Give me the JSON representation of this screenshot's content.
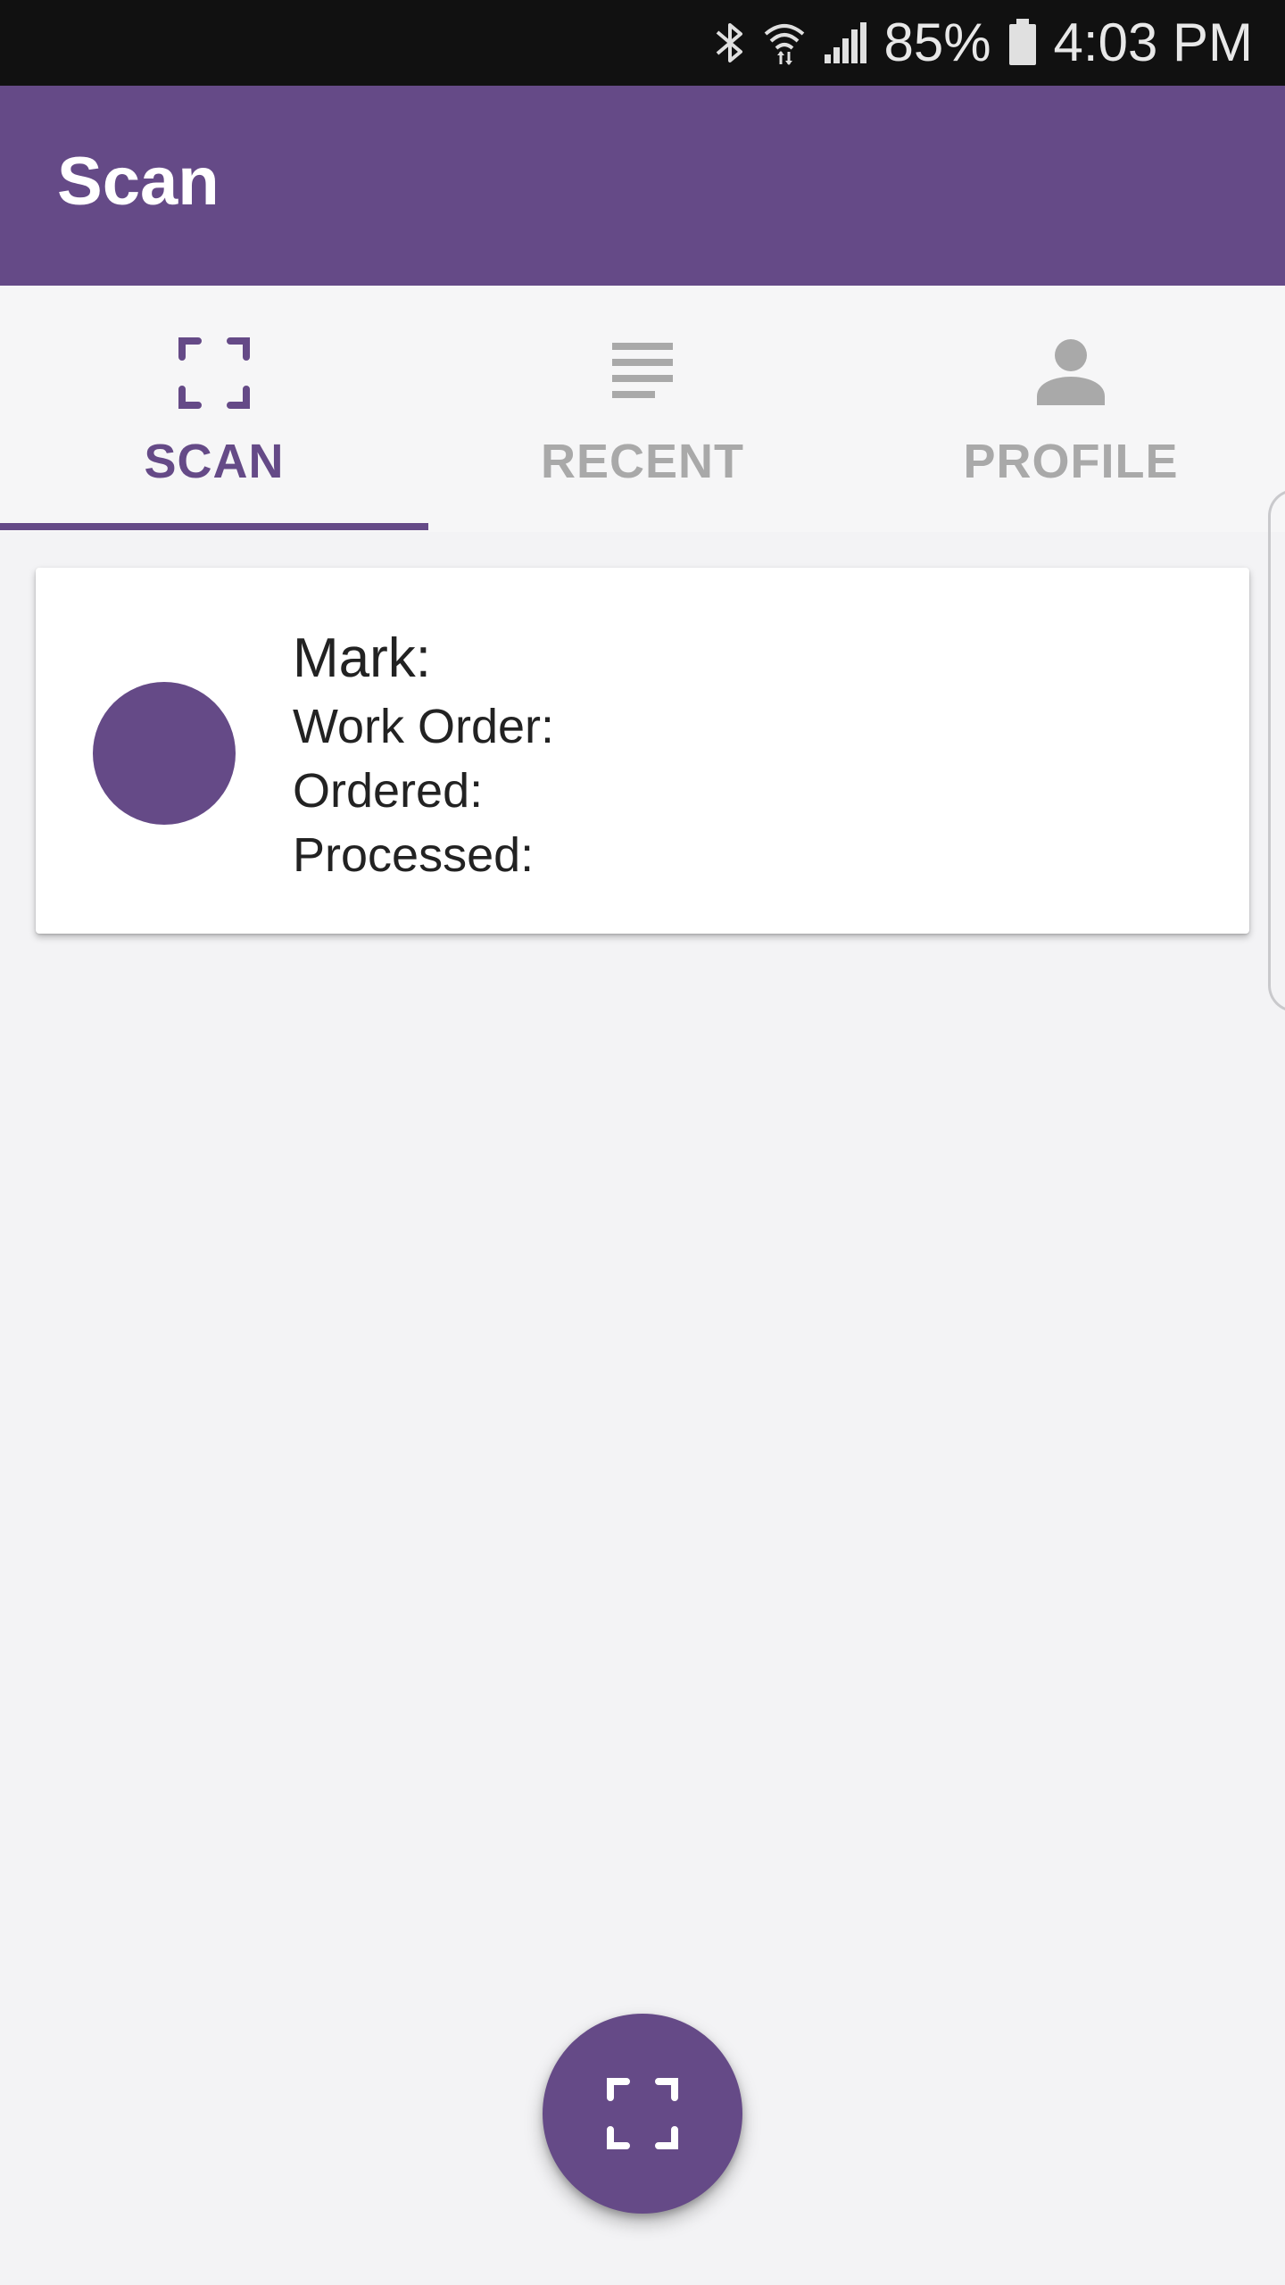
{
  "status_bar": {
    "battery_percent": "85%",
    "time": "4:03 PM",
    "icons": [
      "bluetooth-icon",
      "wifi-icon",
      "signal-icon",
      "battery-icon"
    ]
  },
  "app_bar": {
    "title": "Scan"
  },
  "tabs": [
    {
      "label": "SCAN",
      "icon": "scan-frame-icon",
      "active": true
    },
    {
      "label": "RECENT",
      "icon": "list-lines-icon",
      "active": false
    },
    {
      "label": "PROFILE",
      "icon": "person-icon",
      "active": false
    }
  ],
  "card": {
    "mark_label": "Mark:",
    "work_order_label": "Work Order:",
    "ordered_label": "Ordered:",
    "processed_label": "Processed:"
  },
  "fab": {
    "icon": "scan-frame-icon"
  },
  "colors": {
    "primary": "#654a87",
    "status_bar": "#111111",
    "background": "#f3f3f5",
    "tab_inactive": "#a9a9a9",
    "text": "#222222"
  }
}
